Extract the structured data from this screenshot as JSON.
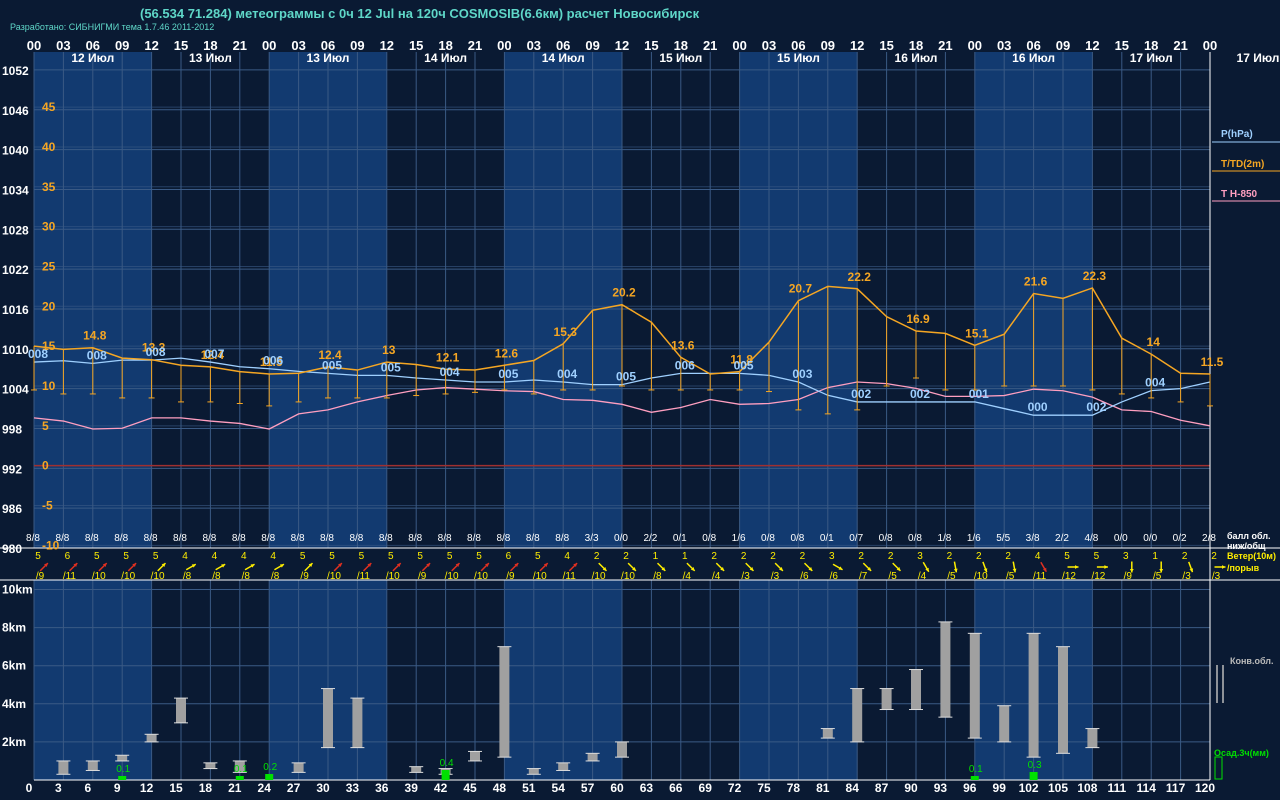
{
  "header": {
    "title": "(56.534 71.284) метеограммы с  0ч 12 Jul на 120ч COSMOSIB(6.6км) расчет Новосибирск",
    "subtitle": "Разработано: СИБНИГМИ тема 1.7.46 2011-2012"
  },
  "chart_data": {
    "type": "line",
    "top_hours": [
      "00",
      "03",
      "06",
      "09",
      "12",
      "15",
      "18",
      "21",
      "00",
      "03",
      "06",
      "09",
      "12",
      "15",
      "18",
      "21",
      "00",
      "03",
      "06",
      "09",
      "12",
      "15",
      "18",
      "21",
      "00",
      "03",
      "06",
      "09",
      "12",
      "15",
      "18",
      "21",
      "00",
      "03",
      "06",
      "09",
      "12",
      "15",
      "18",
      "21",
      "00"
    ],
    "bottom_hours": [
      "0",
      "3",
      "6",
      "9",
      "12",
      "15",
      "18",
      "21",
      "24",
      "27",
      "30",
      "33",
      "36",
      "39",
      "42",
      "45",
      "48",
      "51",
      "54",
      "57",
      "60",
      "63",
      "66",
      "69",
      "72",
      "75",
      "78",
      "81",
      "84",
      "87",
      "90",
      "93",
      "96",
      "99",
      "102",
      "105",
      "108",
      "111",
      "114",
      "117",
      "120"
    ],
    "day_labels": [
      "12 Июл",
      "13 Июл",
      "13 Июл",
      "14 Июл",
      "14 Июл",
      "15 Июл",
      "15 Июл",
      "16 Июл",
      "16 Июл",
      "17 Июл",
      "17 Июл"
    ],
    "pressure_axis": [
      "1052",
      "1046",
      "1040",
      "1034",
      "1028",
      "1022",
      "1016",
      "1010",
      "1004",
      "998",
      "992",
      "986",
      "980"
    ],
    "temp_axis": [
      "45",
      "40",
      "35",
      "30",
      "25",
      "20",
      "15",
      "10",
      "5",
      "0",
      "-5",
      "-10"
    ],
    "height_axis": [
      "10km",
      "8km",
      "6km",
      "4km",
      "2km"
    ],
    "legend": {
      "pressure": "P(hPa)",
      "temperature": "T/TD(2m)",
      "t850": "T H-850",
      "cloud": "балл обл. ниж/общ",
      "wind": "Ветер(10м) /порыв",
      "conv": "Конв.обл.",
      "precip": "Осад.3ч(мм)"
    },
    "colors": {
      "background": "#0a1a33",
      "band_light": "#123a70",
      "band_dark": "#0a1a33",
      "temperature": "#f5a623",
      "pressure": "#9fd0ff",
      "t850": "#ff9fc0",
      "zero_line": "#a03030",
      "wind_north": "#ffee00",
      "wind_south": "#e03020",
      "precip": "#00e000"
    },
    "temperature": [
      15.0,
      14.6,
      14.8,
      13.5,
      13.3,
      12.6,
      12.4,
      11.8,
      11.5,
      11.6,
      12.4,
      12.0,
      13.0,
      12.7,
      12.1,
      12.0,
      12.6,
      13.2,
      15.3,
      19.5,
      20.2,
      18.0,
      13.6,
      11.5,
      11.8,
      15.5,
      20.7,
      22.5,
      22.2,
      18.7,
      16.9,
      16.6,
      15.1,
      16.5,
      21.6,
      21.0,
      22.3,
      16.0,
      14.0,
      11.6,
      11.5
    ],
    "temperature_labels": [
      null,
      null,
      "14.8",
      null,
      "13.3",
      null,
      "12.4",
      null,
      "11.5",
      null,
      "12.4",
      null,
      "13",
      null,
      "12.1",
      null,
      "12.6",
      null,
      "15.3",
      null,
      "20.2",
      null,
      "13.6",
      null,
      "11.8",
      null,
      "20.7",
      null,
      "22.2",
      null,
      "16.9",
      null,
      "15.1",
      null,
      "21.6",
      null,
      "22.3",
      null,
      "14",
      null,
      "11.5"
    ],
    "dewpoint": [
      9.5,
      9.0,
      9.0,
      8.5,
      8.5,
      8.0,
      8.0,
      7.8,
      7.5,
      8.0,
      8.5,
      8.5,
      8.5,
      8.8,
      9.0,
      9.2,
      9.5,
      9.0,
      9.5,
      9.5,
      10.0,
      9.5,
      9.5,
      9.5,
      9.5,
      9.3,
      7.0,
      6.5,
      7.0,
      10.0,
      11.0,
      9.5,
      9.5,
      10.0,
      10.0,
      10.0,
      9.5,
      9.0,
      8.5,
      8.0,
      7.5
    ],
    "pressure": [
      1008.0,
      1008.2,
      1007.8,
      1008.3,
      1008.3,
      1008.6,
      1008.0,
      1007.3,
      1007.0,
      1006.6,
      1006.3,
      1006.0,
      1006.0,
      1005.6,
      1005.3,
      1005.0,
      1005.0,
      1005.3,
      1005.0,
      1004.6,
      1004.6,
      1005.6,
      1006.3,
      1006.3,
      1006.3,
      1006.0,
      1005.0,
      1003.0,
      1002.0,
      1002.0,
      1002.0,
      1002.0,
      1002.0,
      1001.0,
      1000.0,
      1000.0,
      1000.0,
      1002.0,
      1003.7,
      1004.0,
      1005.0
    ],
    "t850": [
      6.0,
      5.6,
      4.6,
      4.7,
      6.0,
      6.0,
      5.6,
      5.3,
      4.6,
      6.5,
      7.0,
      8.0,
      8.8,
      9.5,
      9.8,
      9.6,
      9.4,
      9.3,
      8.3,
      8.2,
      7.7,
      6.7,
      7.3,
      8.3,
      7.7,
      7.8,
      8.3,
      9.8,
      10.5,
      10.3,
      9.7,
      8.7,
      8.7,
      8.8,
      9.6,
      9.4,
      8.6,
      7.0,
      6.8,
      5.7,
      5.0
    ],
    "cloud_codes": [
      "008",
      null,
      "008",
      null,
      "008",
      null,
      "007",
      null,
      "006",
      null,
      "005",
      null,
      "005",
      null,
      "004",
      null,
      "005",
      null,
      "004",
      null,
      "005",
      null,
      "006",
      null,
      "005",
      null,
      "003",
      null,
      "002",
      null,
      "002",
      null,
      "001",
      null,
      "000",
      null,
      "002",
      null,
      "004"
    ],
    "cloud_fraction": [
      "8/8",
      "8/8",
      "8/8",
      "8/8",
      "8/8",
      "8/8",
      "8/8",
      "8/8",
      "8/8",
      "8/8",
      "8/8",
      "8/8",
      "8/8",
      "8/8",
      "8/8",
      "8/8",
      "8/8",
      "8/8",
      "8/8",
      "3/3",
      "0/0",
      "2/2",
      "0/1",
      "0/8",
      "1/6",
      "0/8",
      "0/8",
      "0/1",
      "0/7",
      "0/8",
      "0/8",
      "1/8",
      "1/6",
      "5/5",
      "3/8",
      "2/2",
      "4/8",
      "0/0",
      "0/0",
      "0/2",
      "2/8"
    ],
    "wind_speed": [
      "5",
      "6",
      "5",
      "5",
      "5",
      "4",
      "4",
      "4",
      "4",
      "5",
      "5",
      "5",
      "5",
      "5",
      "5",
      "5",
      "6",
      "5",
      "4",
      "2",
      "2",
      "1",
      "1",
      "2",
      "2",
      "2",
      "2",
      "3",
      "2",
      "2",
      "3",
      "2",
      "2",
      "2",
      "4",
      "5",
      "5",
      "3",
      "1",
      "2",
      "2"
    ],
    "wind_gust": [
      "/9",
      "/11",
      "/10",
      "/10",
      "/10",
      "/8",
      "/8",
      "/8",
      "/8",
      "/9",
      "/10",
      "/11",
      "/10",
      "/9",
      "/10",
      "/10",
      "/9",
      "/10",
      "/11",
      "/10",
      "/10",
      "/8",
      "/4",
      "/4",
      "/3",
      "/3",
      "/6",
      "/6",
      "/7",
      "/5",
      "/4",
      "/5",
      "/10",
      "/5",
      "/11",
      "/12",
      "/12",
      "/9",
      "/5",
      "/3",
      "/3"
    ],
    "wind_dir": [
      135,
      135,
      135,
      135,
      135,
      120,
      120,
      120,
      120,
      135,
      135,
      135,
      135,
      135,
      135,
      135,
      135,
      135,
      135,
      45,
      45,
      45,
      45,
      45,
      45,
      45,
      45,
      60,
      45,
      45,
      30,
      10,
      20,
      10,
      30,
      90,
      90,
      0,
      0,
      20,
      90
    ],
    "wind_type": [
      "S",
      "S",
      "S",
      "S",
      "N",
      "N",
      "N",
      "N",
      "N",
      "N",
      "S",
      "S",
      "S",
      "S",
      "S",
      "S",
      "S",
      "S",
      "S",
      "N",
      "N",
      "N",
      "N",
      "N",
      "N",
      "N",
      "N",
      "N",
      "N",
      "N",
      "N",
      "N",
      "N",
      "N",
      "S",
      "N",
      "N",
      "N",
      "N",
      "N",
      "N"
    ],
    "convective_clouds": [
      {
        "h": 3,
        "base": 0.3,
        "top": 1.0
      },
      {
        "h": 6,
        "base": 0.5,
        "top": 1.0
      },
      {
        "h": 9,
        "base": 1.0,
        "top": 1.3
      },
      {
        "h": 12,
        "base": 2.0,
        "top": 2.4
      },
      {
        "h": 15,
        "base": 3.0,
        "top": 4.3
      },
      {
        "h": 18,
        "base": 0.6,
        "top": 0.9
      },
      {
        "h": 21,
        "base": 0.4,
        "top": 1.0
      },
      {
        "h": 27,
        "base": 0.4,
        "top": 0.9
      },
      {
        "h": 30,
        "base": 1.7,
        "top": 4.8
      },
      {
        "h": 33,
        "base": 1.7,
        "top": 4.3
      },
      {
        "h": 39,
        "base": 0.4,
        "top": 0.7
      },
      {
        "h": 42,
        "base": 0.3,
        "top": 0.6
      },
      {
        "h": 45,
        "base": 1.0,
        "top": 1.5
      },
      {
        "h": 48,
        "base": 1.2,
        "top": 7.0
      },
      {
        "h": 51,
        "base": 0.3,
        "top": 0.6
      },
      {
        "h": 54,
        "base": 0.5,
        "top": 0.9
      },
      {
        "h": 57,
        "base": 1.0,
        "top": 1.4
      },
      {
        "h": 60,
        "base": 1.2,
        "top": 2.0
      },
      {
        "h": 81,
        "base": 2.2,
        "top": 2.7
      },
      {
        "h": 84,
        "base": 2.0,
        "top": 4.8
      },
      {
        "h": 87,
        "base": 3.7,
        "top": 4.8
      },
      {
        "h": 90,
        "base": 3.7,
        "top": 5.8
      },
      {
        "h": 93,
        "base": 3.3,
        "top": 8.3
      },
      {
        "h": 96,
        "base": 2.2,
        "top": 7.7
      },
      {
        "h": 99,
        "base": 2.0,
        "top": 3.9
      },
      {
        "h": 102,
        "base": 1.2,
        "top": 7.7
      },
      {
        "h": 105,
        "base": 1.4,
        "top": 7.0
      },
      {
        "h": 108,
        "base": 1.7,
        "top": 2.7
      }
    ],
    "precipitation": [
      {
        "h": 9,
        "value": 0.1,
        "label": "0.1"
      },
      {
        "h": 21,
        "value": 0.1,
        "label": "0.1"
      },
      {
        "h": 24,
        "value": 0.2,
        "label": "0.2"
      },
      {
        "h": 42,
        "value": 0.4,
        "label": "0.4"
      },
      {
        "h": 96,
        "value": 0.1,
        "label": "0.1"
      },
      {
        "h": 102,
        "value": 0.3,
        "label": "0.3"
      }
    ],
    "ylim_pressure": [
      980,
      1055
    ],
    "ylim_temp": [
      -12.5,
      50
    ],
    "ylim_height_km": [
      0,
      10.5
    ],
    "grid": true
  }
}
